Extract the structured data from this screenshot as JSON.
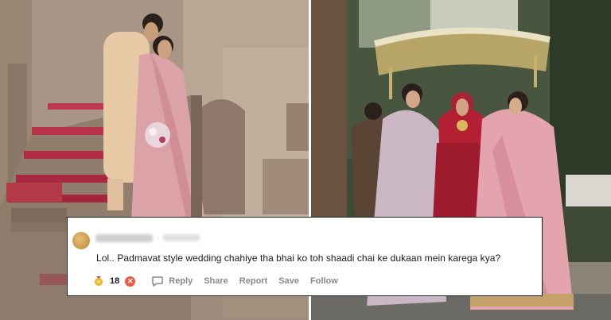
{
  "comment": {
    "username": "Wise-Turn8220",
    "age": "1 day ago",
    "text": "Lol.. Padmavat style wedding chahiye tha bhai ko toh shaadi chai ke dukaan mein karega kya?",
    "vote_count": "18",
    "actions": {
      "reply": "Reply",
      "share": "Share",
      "report": "Report",
      "save": "Save",
      "follow": "Follow"
    },
    "icons": {
      "upvote": "award-medal-icon",
      "downvote": "downvote-icon",
      "reply": "speech-bubble-icon"
    },
    "colors": {
      "downvote": "#ee5c40",
      "action_text": "#878a8c",
      "comment_text": "#1a1a1b"
    }
  }
}
